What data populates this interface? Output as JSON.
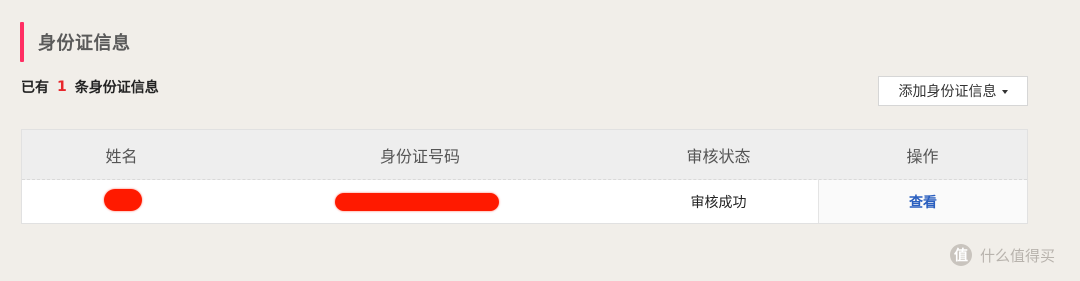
{
  "section": {
    "title": "身份证信息"
  },
  "summary": {
    "prefix": "已有",
    "count": "1",
    "suffix": "条身份证信息"
  },
  "add_button": {
    "label": "添加身份证信息"
  },
  "table": {
    "columns": [
      "姓名",
      "身份证号码",
      "审核状态",
      "操作"
    ],
    "rows": [
      {
        "name": "",
        "id_number": "",
        "status": "审核成功",
        "action": "查看"
      }
    ]
  },
  "colors": {
    "accent": "#ff2e63",
    "count": "#e8262b",
    "link": "#2a5fbf",
    "redaction": "#ff1a00",
    "background": "#f1eee9"
  },
  "watermark": {
    "logo": "值",
    "text": "什么值得买"
  }
}
